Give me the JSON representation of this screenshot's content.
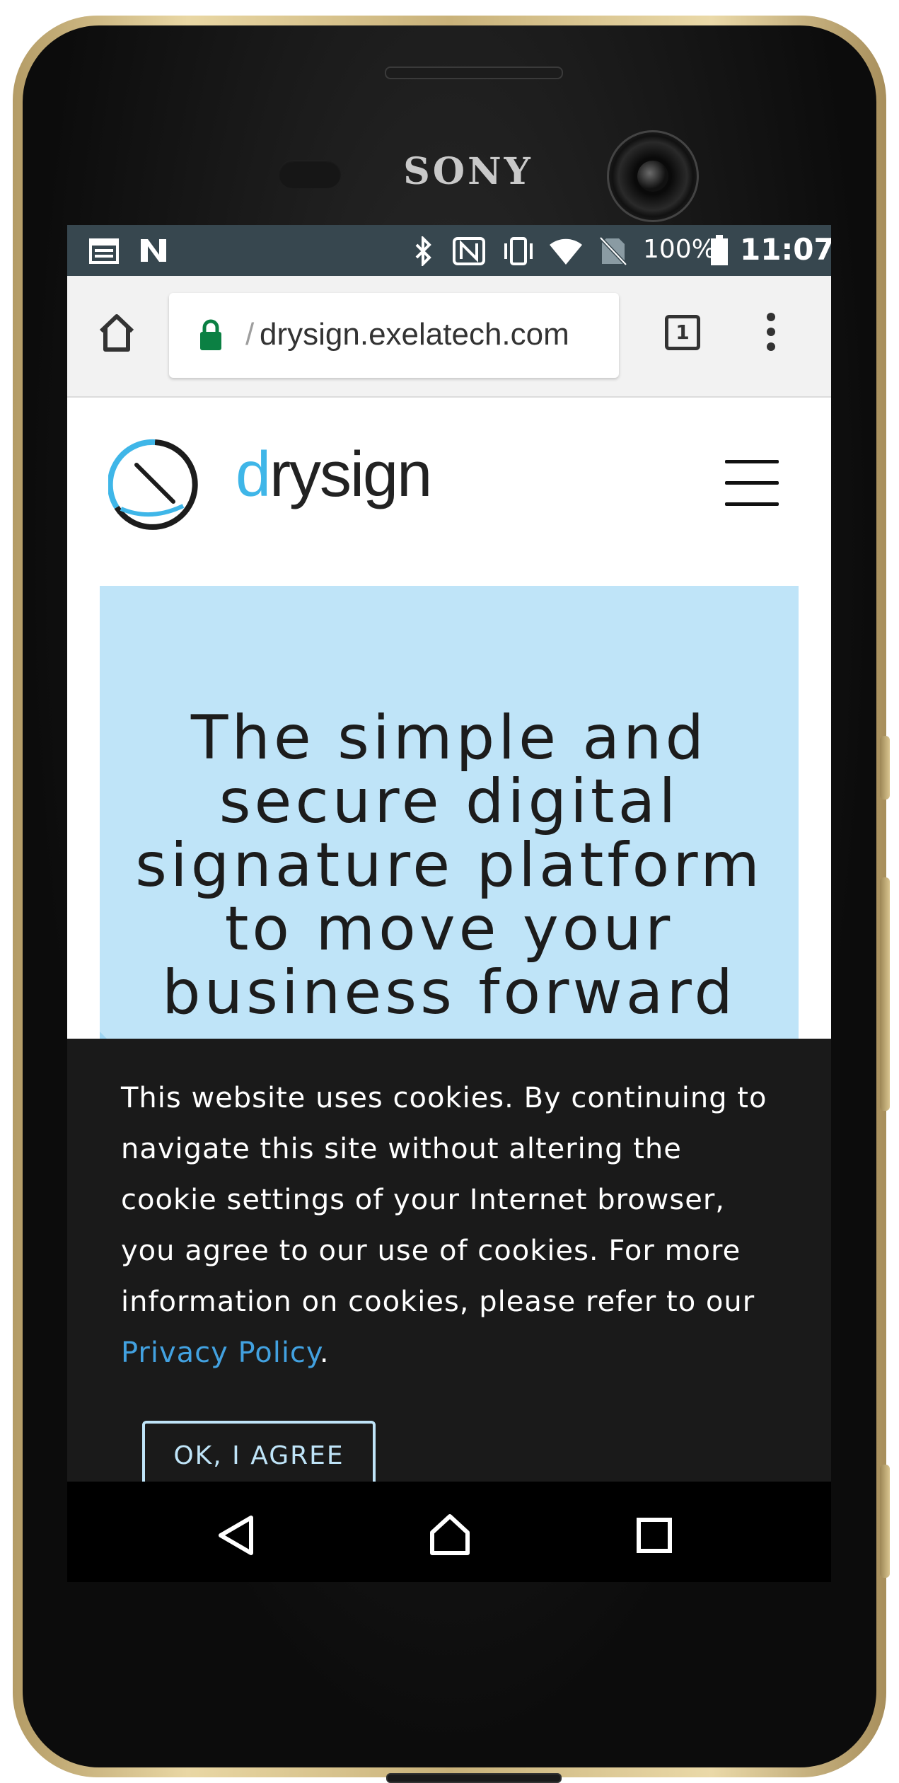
{
  "device": {
    "brand": "SONY"
  },
  "statusbar": {
    "battery_percent": "100%",
    "time": "11:07",
    "icons": [
      "calendar-icon",
      "nfc-app-icon",
      "bluetooth-icon",
      "nfc-icon",
      "vibrate-icon",
      "wifi-icon",
      "no-sim-icon",
      "battery-icon"
    ]
  },
  "browser": {
    "url_prefix": "/",
    "url": "drysign.exelatech.com",
    "tab_count": "1"
  },
  "site": {
    "logo_d": "d",
    "logo_rest": "rysign",
    "hero_title": "The simple and secure digital signature platform to move your business forward"
  },
  "cookie": {
    "text": "This website uses cookies. By continuing to navigate this site without altering the cookie settings of your Internet browser, you agree to our use of cookies. For more information on cookies, please refer to our ",
    "link_text": "Privacy Policy",
    "suffix": ".",
    "button_label": "OK, I AGREE"
  },
  "colors": {
    "statusbar_bg": "#37474f",
    "hero_bg": "#bfe4f8",
    "accent_blue": "#3fb6e8",
    "link_blue": "#42a1e0",
    "cookie_bg": "#1a1a1a",
    "lock_green": "#0b8043"
  }
}
